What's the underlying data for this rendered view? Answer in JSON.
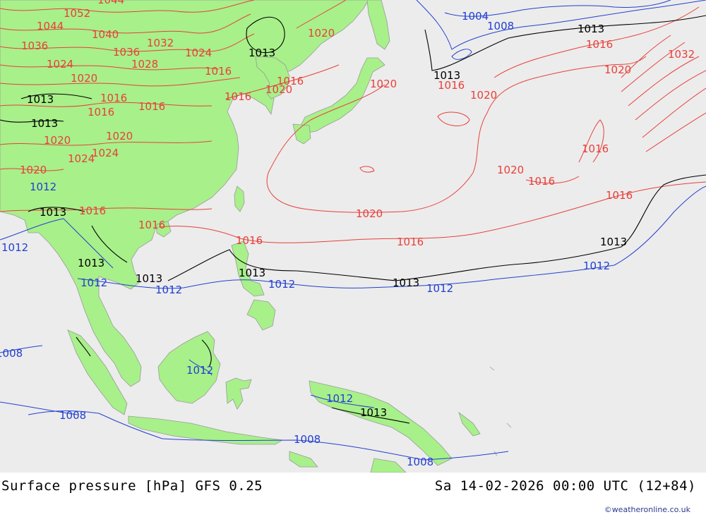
{
  "map": {
    "colors": {
      "ocean": "#ececec",
      "land": "#a8f08a",
      "coast": "#9a9a9a",
      "isobar_high": "#e8403a",
      "isobar_std": "#000000",
      "isobar_low": "#2340d0"
    },
    "isobar_labels": {
      "l1044": "1044",
      "l1052": "1052",
      "l1040": "1040",
      "l1036": "1036",
      "l1032": "1032",
      "l1028": "1028",
      "l1024": "1024",
      "l1020": "1020",
      "l1016": "1016",
      "l1013": "1013",
      "l1012": "1012",
      "l1008": "1008",
      "l1004": "1004"
    }
  },
  "footer": {
    "title": "Surface pressure [hPa] GFS 0.25",
    "datetime": "Sa 14-02-2026 00:00 UTC (12+84)",
    "credit": "©weatheronline.co.uk"
  }
}
